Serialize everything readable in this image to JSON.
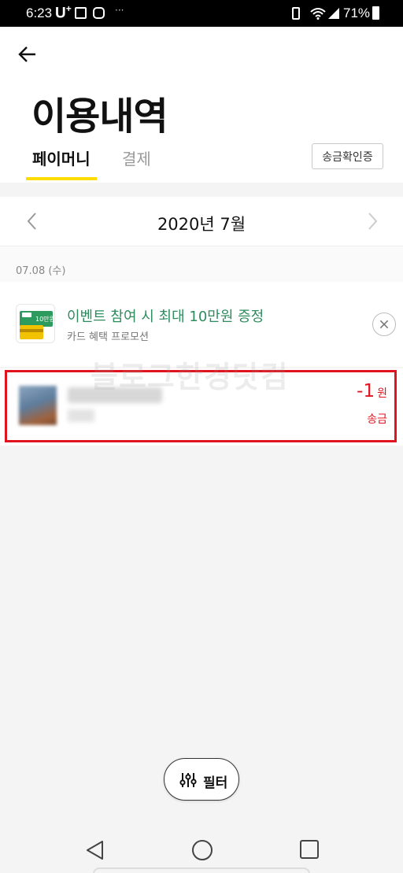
{
  "status_bar": {
    "time": "6:23",
    "carrier": "U",
    "carrier_sup": "+",
    "dots": "···",
    "battery": "71%"
  },
  "header": {
    "title": "이용내역",
    "tabs": [
      {
        "label": "페이머니",
        "active": true
      },
      {
        "label": "결제",
        "active": false
      }
    ],
    "verify_button": "송금확인증"
  },
  "month_nav": {
    "label": "2020년 7월"
  },
  "date_group": {
    "label": "07.08 (수)"
  },
  "promo": {
    "title": "이벤트 참여 시 최대 10만원 증정",
    "subtitle": "카드 혜택 프로모션",
    "badge_text": "10만원"
  },
  "transaction": {
    "name": "",
    "subtitle": "",
    "amount": "-1",
    "unit": "원",
    "type": "송금"
  },
  "watermark": "블로그한경닷컴",
  "filter_button": {
    "label": "필터"
  },
  "colors": {
    "accent_yellow": "#ffdc00",
    "promo_green": "#2e8c5e",
    "amount_red": "#e0141e",
    "highlight_red": "#e0141e"
  },
  "icons": [
    "back-arrow-icon",
    "chevron-left-icon",
    "chevron-right-icon",
    "close-icon",
    "filter-sliders-icon",
    "nav-back-icon",
    "nav-home-icon",
    "nav-recent-icon"
  ]
}
